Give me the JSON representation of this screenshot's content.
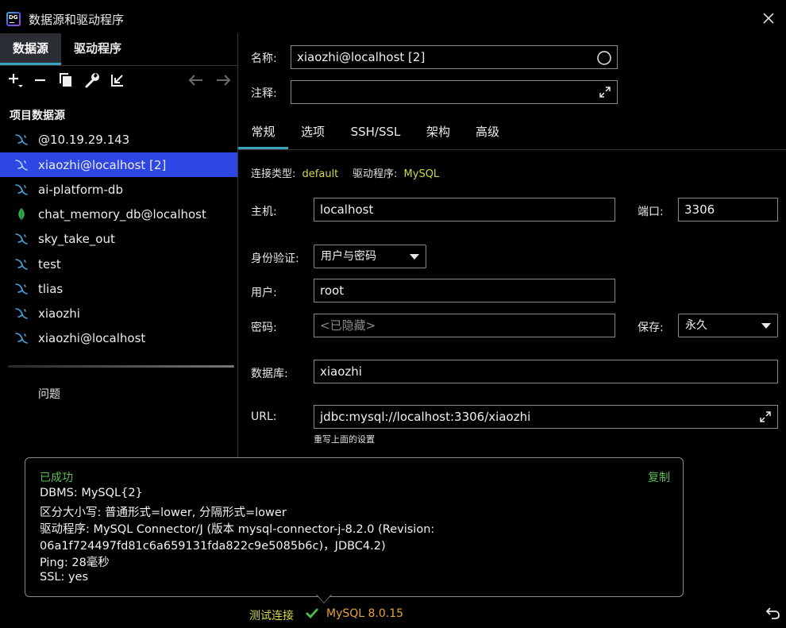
{
  "window": {
    "logo_text": "DG",
    "title": "数据源和驱动程序"
  },
  "left": {
    "tabs": [
      {
        "label": "数据源",
        "active": true
      },
      {
        "label": "驱动程序",
        "active": false
      }
    ],
    "toolbar_icons": [
      "add-icon",
      "minus-icon",
      "duplicate-icon",
      "wrench-icon",
      "import-icon",
      "back-arrow-icon",
      "forward-arrow-icon"
    ],
    "section_title": "项目数据源",
    "datasources": [
      {
        "label": "@10.19.29.143",
        "icon": "mysql-dolphin-icon"
      },
      {
        "label": "xiaozhi@localhost [2]",
        "icon": "mysql-dolphin-icon",
        "selected": true
      },
      {
        "label": "ai-platform-db",
        "icon": "mysql-dolphin-icon"
      },
      {
        "label": "chat_memory_db@localhost",
        "icon": "mongodb-leaf-icon"
      },
      {
        "label": "sky_take_out",
        "icon": "mysql-dolphin-icon"
      },
      {
        "label": "test",
        "icon": "mysql-dolphin-icon"
      },
      {
        "label": "tlias",
        "icon": "mysql-dolphin-icon"
      },
      {
        "label": "xiaozhi",
        "icon": "mysql-dolphin-icon"
      },
      {
        "label": "xiaozhi@localhost",
        "icon": "mysql-dolphin-icon"
      }
    ],
    "problems_label": "问题"
  },
  "right": {
    "name_label": "名称:",
    "name_value": "xiaozhi@localhost [2]",
    "comment_label": "注释:",
    "comment_value": "",
    "subtabs": [
      {
        "label": "常规",
        "active": true
      },
      {
        "label": "选项",
        "active": false
      },
      {
        "label": "SSH/SSL",
        "active": false
      },
      {
        "label": "架构",
        "active": false
      },
      {
        "label": "高级",
        "active": false
      }
    ],
    "conn_type_label": "连接类型:",
    "conn_type_value": "default",
    "driver_label": "驱动程序:",
    "driver_value": "MySQL",
    "host_label": "主机:",
    "host_value": "localhost",
    "port_label": "端口:",
    "port_value": "3306",
    "auth_label": "身份验证:",
    "auth_value": "用户与密码",
    "user_label": "用户:",
    "user_value": "root",
    "password_label": "密码:",
    "password_placeholder": "<已隐藏>",
    "save_label": "保存:",
    "save_value": "永久",
    "database_label": "数据库:",
    "database_value": "xiaozhi",
    "url_label": "URL:",
    "url_value": "jdbc:mysql://localhost:3306/xiaozhi",
    "url_hint": "重写上面的设置"
  },
  "popup": {
    "status": "已成功",
    "copy_label": "复制",
    "lines": [
      "DBMS: MySQL{2}",
      "区分大小写: 普通形式=lower, 分隔形式=lower",
      "驱动程序: MySQL Connector/J (版本 mysql-connector-j-8.2.0 (Revision:",
      "06a1f724497fd81c6a659131fda822c9e5085b6c)，JDBC4.2)",
      "Ping: 28毫秒",
      "SSL: yes"
    ]
  },
  "bottom": {
    "test_connection_label": "测试连接",
    "mysql_version": "MySQL 8.0.15"
  },
  "colors": {
    "accent_tab": "#3aa3c0",
    "selection": "#2d46e4",
    "success": "#5bbb55",
    "yellow_link": "#d0d94a",
    "orange": "#e7a13a"
  }
}
